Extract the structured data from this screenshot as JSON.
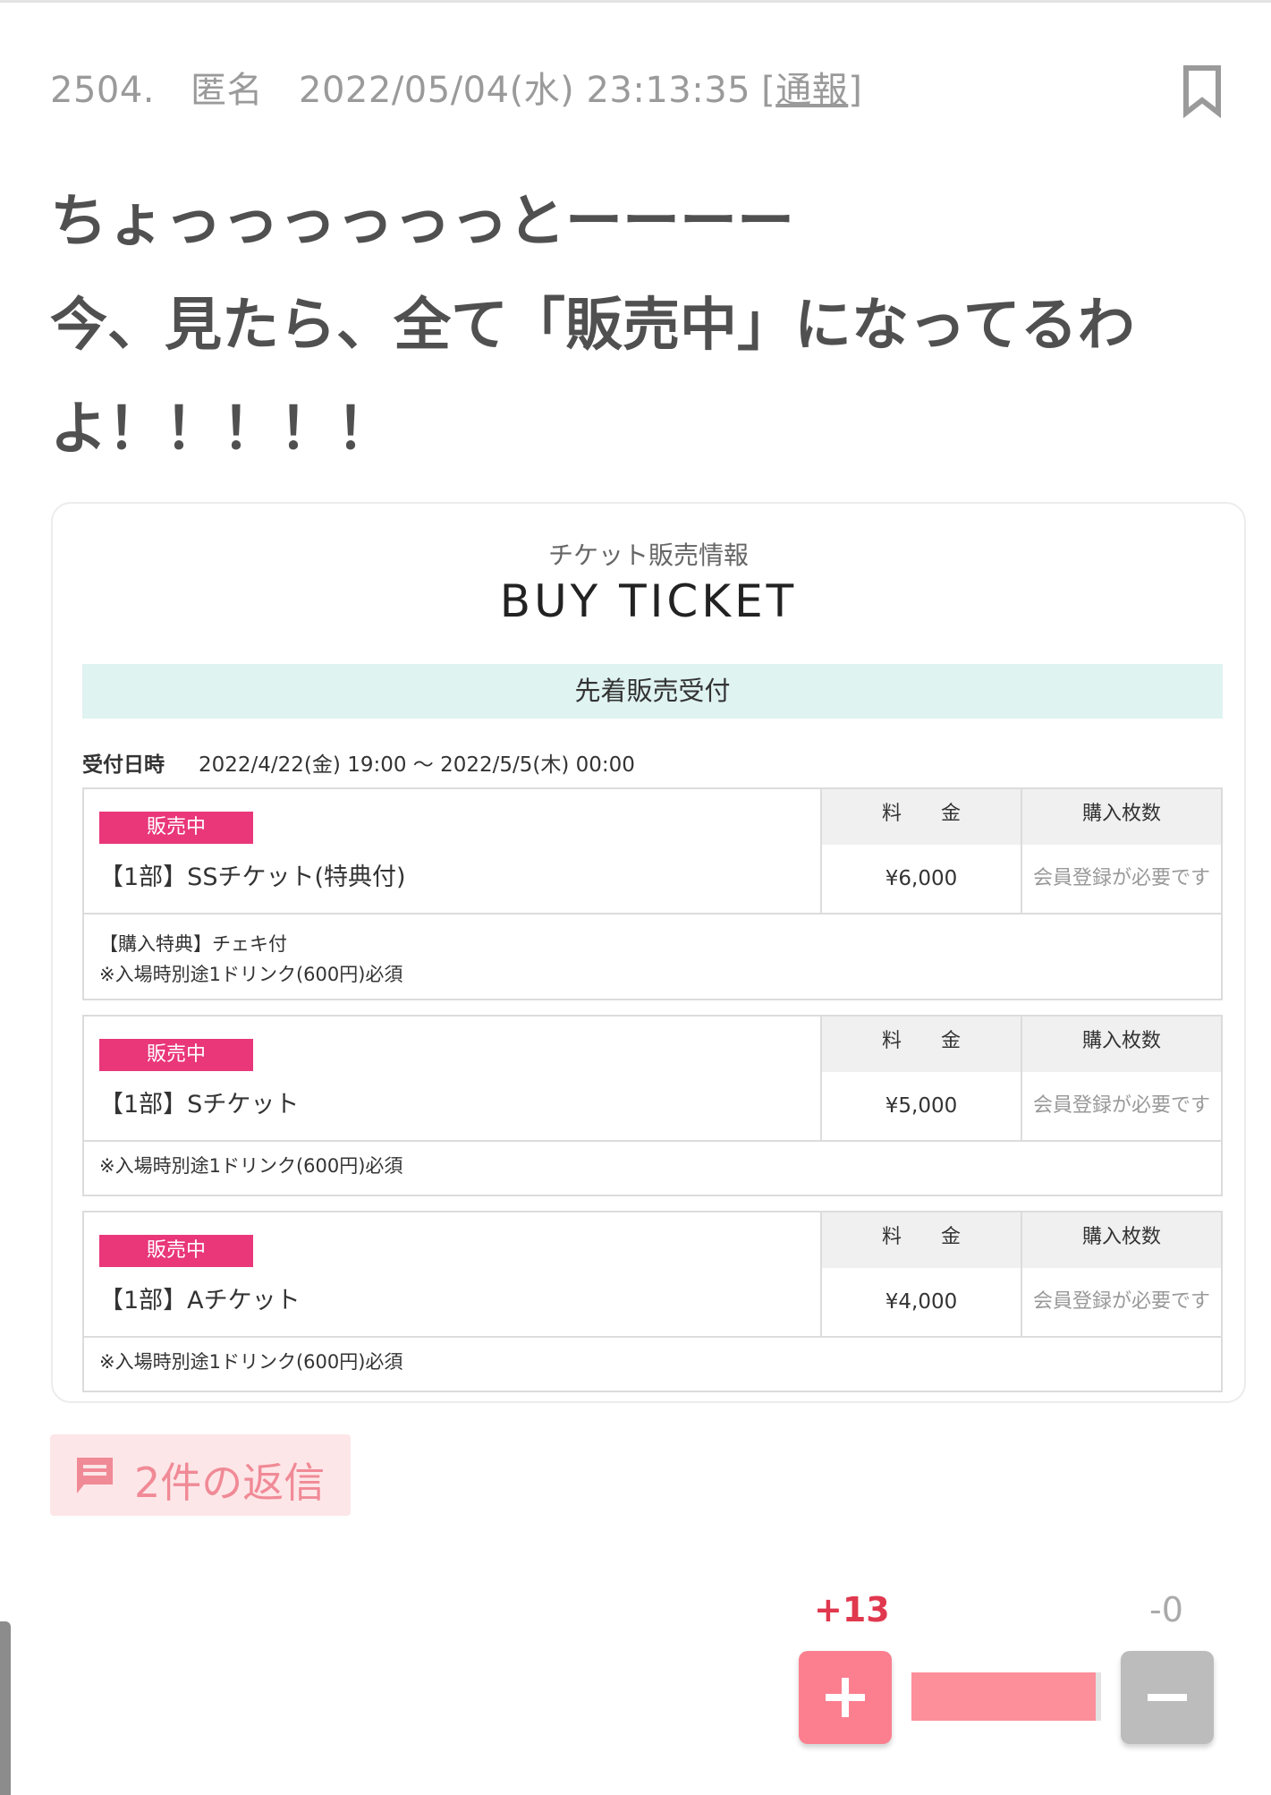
{
  "post": {
    "number": "2504.",
    "author": "匿名",
    "datetime": "2022/05/04(水) 23:13:35",
    "report_open": "[",
    "report_label": "通報",
    "report_close": "]",
    "body_lines": [
      "ちょっっっっっっとーーーー",
      "今、見たら、全て「販売中」になってるわ",
      "よ！！！！！"
    ]
  },
  "ticket_card": {
    "subtitle": "チケット販売情報",
    "title": "BUY TICKET",
    "sale_type": "先着販売受付",
    "period_label": "受付日時",
    "period_value": "2022/4/22(金) 19:00 ～ 2022/5/5(木) 00:00",
    "tickets": [
      {
        "status": "販売中",
        "name": "【1部】SSチケット(特典付)",
        "price_label": "料　　金",
        "price": "¥6,000",
        "qty_label": "購入枚数",
        "qty_value": "会員登録が必要です",
        "notes": [
          "【購入特典】チェキ付",
          "※入場時別途1ドリンク(600円)必須"
        ]
      },
      {
        "status": "販売中",
        "name": "【1部】Sチケット",
        "price_label": "料　　金",
        "price": "¥5,000",
        "qty_label": "購入枚数",
        "qty_value": "会員登録が必要です",
        "notes": [
          "※入場時別途1ドリンク(600円)必須"
        ]
      },
      {
        "status": "販売中",
        "name": "【1部】Aチケット",
        "price_label": "料　　金",
        "price": "¥4,000",
        "qty_label": "購入枚数",
        "qty_value": "会員登録が必要です",
        "notes": [
          "※入場時別途1ドリンク(600円)必須"
        ]
      }
    ]
  },
  "replies": {
    "label": "2件の返信",
    "icon": "comment-icon"
  },
  "votes": {
    "plus": "+13",
    "minus": "-0",
    "plus_ratio": 0.97,
    "plus_icon": "plus-icon",
    "minus_icon": "minus-icon"
  },
  "colors": {
    "badge": "#e9377a",
    "banner": "#dff3f1",
    "plus": "#fb7f8f",
    "plus_text": "#e0384e",
    "minus": "#bcbcbc",
    "reply_bg": "#fde6e8"
  }
}
